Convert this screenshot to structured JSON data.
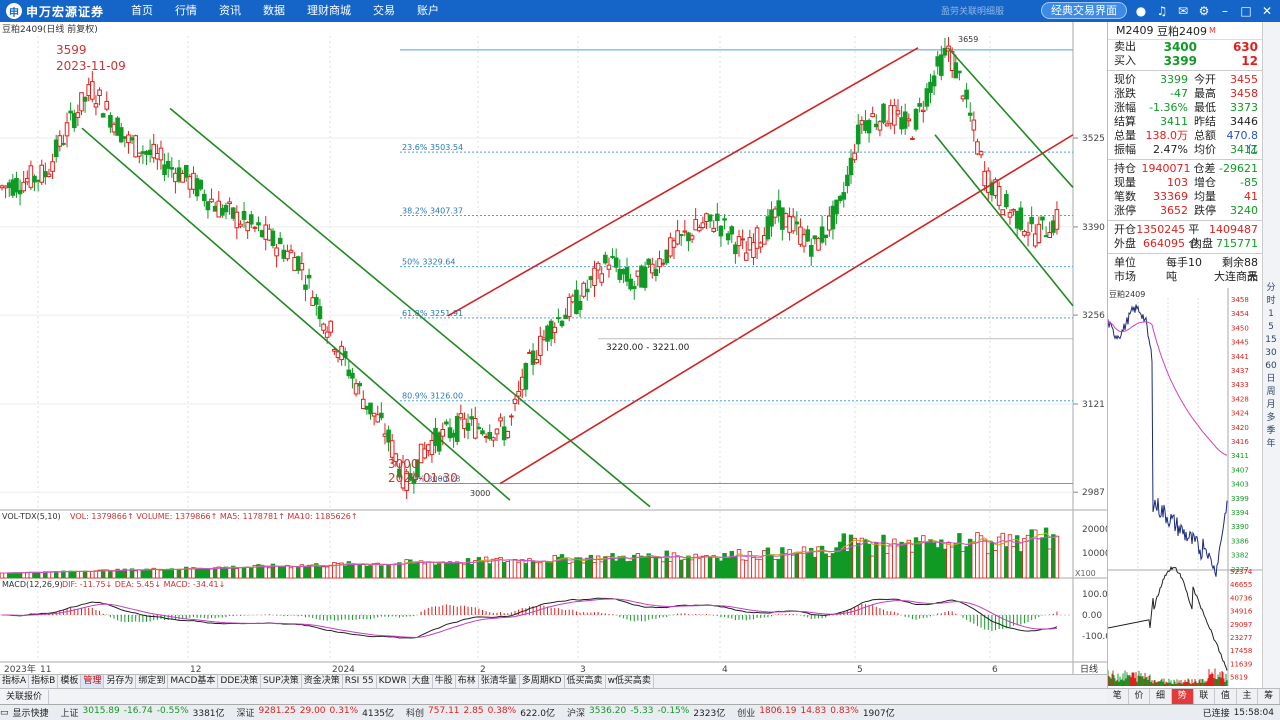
{
  "app": {
    "brand": "申万宏源证券",
    "logo_mark": "申"
  },
  "menu": [
    "首页",
    "行情",
    "资讯",
    "数据",
    "理财商城",
    "交易",
    "账户"
  ],
  "top": {
    "faint_text": "盈劳关联明细服",
    "classic_label": "经典交易界面"
  },
  "chart": {
    "symbol_title": "豆粕2409(日线 前复权)",
    "high_price": "3599",
    "high_date": "2023-11-09",
    "low_price": "3000",
    "low_date": "2024-01-30",
    "peak_label": "3659",
    "trough_label": "3000",
    "range_label": "3220.00 - 3221.00",
    "fib": [
      {
        "label": "23.6% 3503.54",
        "price": 3503.54
      },
      {
        "label": "38.2% 3407.37",
        "price": 3407.37
      },
      {
        "label": "50% 3329.64",
        "price": 3329.64
      },
      {
        "label": "61.8% 3251.91",
        "price": 3251.91
      },
      {
        "label": "80.9% 3126.00",
        "price": 3126.0
      },
      {
        "label": "100% 3000.28",
        "price": 3000.28
      }
    ],
    "y_ticks": [
      "3525",
      "3390",
      "3256",
      "3121",
      "2987"
    ],
    "x_ticks": [
      "2023年",
      "11",
      "12",
      "2024",
      "2",
      "3",
      "4",
      "5",
      "6"
    ],
    "vol_title": "VOL-TDX(5,10)",
    "vol_vals": "VOL: 1379866↑  VOLUME: 1379866↑  MA5: 1178781↑  MA10: 1185626↑",
    "vol_ticks": [
      "20000",
      "10000"
    ],
    "vol_unit": "X100",
    "macd_title": "MACD(12,26,9)",
    "macd_vals": "DIF: -11.75↓  DEA: 5.45↓  MACD: -34.41↓",
    "macd_ticks": [
      "100.0",
      "0.00",
      "-100.0"
    ],
    "period": "日线"
  },
  "quote": {
    "code": "M2409",
    "name": "豆粕2409",
    "tag": "M",
    "ask_label": "卖出",
    "ask": "3400",
    "ask_vol": "630",
    "bid_label": "买入",
    "bid": "3399",
    "bid_vol": "12",
    "rows": [
      [
        "现价",
        "3399",
        "今开",
        "3455"
      ],
      [
        "涨跌",
        "-47",
        "最高",
        "3458"
      ],
      [
        "涨幅",
        "-1.36%",
        "最低",
        "3373"
      ],
      [
        "结算",
        "3411",
        "昨结",
        "3446"
      ],
      [
        "总量",
        "138.0万",
        "总额",
        "470.8亿"
      ],
      [
        "振幅",
        "2.47%",
        "均价",
        "3411"
      ]
    ],
    "rows2": [
      [
        "持仓",
        "1940071",
        "仓差",
        "-29621"
      ],
      [
        "现量",
        "103",
        "增仓",
        "-85"
      ],
      [
        "笔数",
        "33369",
        "均量",
        "41"
      ],
      [
        "涨停",
        "3652",
        "跌停",
        "3240"
      ]
    ],
    "rows3": [
      [
        "开仓",
        "1350245",
        "平仓",
        "1409487"
      ],
      [
        "外盘",
        "664095",
        "内盘",
        "715771"
      ]
    ],
    "unit_label": "单位",
    "unit_val": "每手10吨",
    "remain": "剩余88天",
    "market_label": "市场",
    "market_val": "大连商品",
    "mini_title": "豆粕2409",
    "mini_ticks": [
      "3458",
      "3454",
      "3450",
      "3445",
      "3441",
      "3437",
      "3433",
      "3428",
      "3424",
      "3420",
      "3416",
      "3411",
      "3407",
      "3403",
      "3399",
      "3394",
      "3390",
      "3386",
      "3382",
      "3377"
    ],
    "mini_vol_ticks": [
      "52374",
      "46655",
      "40736",
      "34916",
      "29097",
      "23277",
      "17458",
      "11639",
      "5819"
    ]
  },
  "right_icons": [
    "分",
    "时",
    "1",
    "5",
    "15",
    "30",
    "60",
    "日",
    "周",
    "月",
    "多",
    "季",
    "年"
  ],
  "bottom_tabs": [
    "指标A",
    "指标B",
    "模板",
    "管理",
    "另存为",
    "绑定到",
    "MACD基本",
    "DDE决策",
    "SUP决策",
    "资金决策",
    "RSI 55",
    "KDWR",
    "大盘",
    "牛股",
    "布林",
    "张清华量",
    "多周期KD",
    "低买高卖",
    "w低买高卖"
  ],
  "linkbar": [
    "关联报价"
  ],
  "quote_tabs": [
    "笔",
    "价",
    "细",
    "势",
    "联",
    "值",
    "主",
    "筹"
  ],
  "status": {
    "label": "显示快捷",
    "indices": [
      {
        "name": "上证",
        "v": "3015.89",
        "c": "-16.74",
        "p": "-0.55%",
        "a": "3381亿"
      },
      {
        "name": "深证",
        "v": "9281.25",
        "c": "29.00",
        "p": "0.31%",
        "a": "4135亿"
      },
      {
        "name": "科创",
        "v": "757.11",
        "c": "2.85",
        "p": "0.38%",
        "a": "622.0亿"
      },
      {
        "name": "沪深",
        "v": "3536.20",
        "c": "-5.33",
        "p": "-0.15%",
        "a": "2323亿"
      },
      {
        "name": "创业",
        "v": "1806.19",
        "c": "14.83",
        "p": "0.83%",
        "a": "1907亿"
      }
    ],
    "conn": "已连接",
    "time": "15:58:04"
  }
}
